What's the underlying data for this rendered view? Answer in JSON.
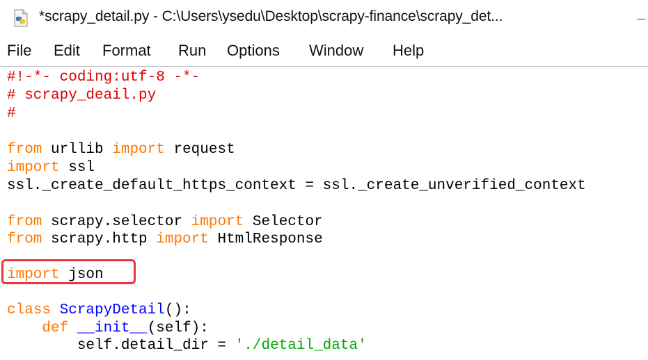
{
  "window": {
    "title": "*scrapy_detail.py - C:\\Users\\ysedu\\Desktop\\scrapy-finance\\scrapy_det..."
  },
  "menu": {
    "items": [
      "File",
      "Edit",
      "Format",
      "Run",
      "Options",
      "Window",
      "Help"
    ]
  },
  "colors": {
    "comment": "#dd0000",
    "keyword": "#ff7700",
    "definition": "#0000ff",
    "string": "#00aa00",
    "highlight_border": "#e8383d"
  },
  "code": {
    "lines": [
      [
        {
          "t": "comment",
          "s": "#!-*- coding:utf-8 -*-"
        }
      ],
      [
        {
          "t": "comment",
          "s": "# scrapy_deail.py"
        }
      ],
      [
        {
          "t": "comment",
          "s": "#"
        }
      ],
      [],
      [
        {
          "t": "keyword",
          "s": "from"
        },
        {
          "t": "plain",
          "s": " urllib "
        },
        {
          "t": "keyword",
          "s": "import"
        },
        {
          "t": "plain",
          "s": " request"
        }
      ],
      [
        {
          "t": "keyword",
          "s": "import"
        },
        {
          "t": "plain",
          "s": " ssl"
        }
      ],
      [
        {
          "t": "plain",
          "s": "ssl._create_default_https_context = ssl._create_unverified_context"
        }
      ],
      [],
      [
        {
          "t": "keyword",
          "s": "from"
        },
        {
          "t": "plain",
          "s": " scrapy.selector "
        },
        {
          "t": "keyword",
          "s": "import"
        },
        {
          "t": "plain",
          "s": " Selector"
        }
      ],
      [
        {
          "t": "keyword",
          "s": "from"
        },
        {
          "t": "plain",
          "s": " scrapy.http "
        },
        {
          "t": "keyword",
          "s": "import"
        },
        {
          "t": "plain",
          "s": " HtmlResponse"
        }
      ],
      [],
      [
        {
          "t": "keyword",
          "s": "import"
        },
        {
          "t": "plain",
          "s": " json"
        }
      ],
      [],
      [
        {
          "t": "keyword",
          "s": "class"
        },
        {
          "t": "plain",
          "s": " "
        },
        {
          "t": "name",
          "s": "ScrapyDetail"
        },
        {
          "t": "plain",
          "s": "():"
        }
      ],
      [
        {
          "t": "plain",
          "s": "    "
        },
        {
          "t": "keyword",
          "s": "def"
        },
        {
          "t": "plain",
          "s": " "
        },
        {
          "t": "name",
          "s": "__init__"
        },
        {
          "t": "plain",
          "s": "(self):"
        }
      ],
      [
        {
          "t": "plain",
          "s": "        self.detail_dir = "
        },
        {
          "t": "string",
          "s": "'./detail_data'"
        }
      ]
    ]
  }
}
